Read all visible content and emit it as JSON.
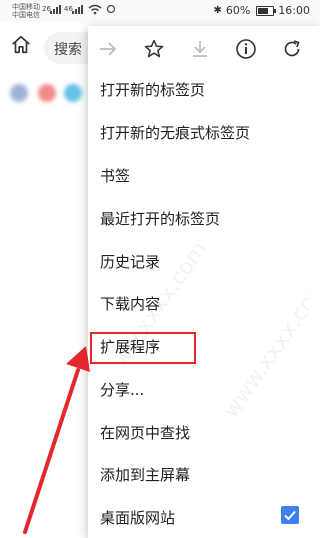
{
  "status_bar": {
    "carrier1": "中国移动",
    "carrier2": "中国电信",
    "sig1": "26",
    "sig2": "46",
    "battery": "60%",
    "time": "16:00"
  },
  "toolbar": {
    "search_text": "搜索"
  },
  "menu": {
    "icons": [
      "forward-icon",
      "bookmark-star-icon",
      "download-icon",
      "info-icon",
      "refresh-icon"
    ],
    "items": [
      "打开新的标签页",
      "打开新的无痕式标签页",
      "书签",
      "最近打开的标签页",
      "历史记录",
      "下载内容",
      "扩展程序",
      "分享...",
      "在网页中查找",
      "添加到主屏幕",
      "桌面版网站"
    ],
    "desktop_site_checked": true
  },
  "colors": {
    "highlight": "#e5262a",
    "checkbox": "#3f7ff0"
  }
}
